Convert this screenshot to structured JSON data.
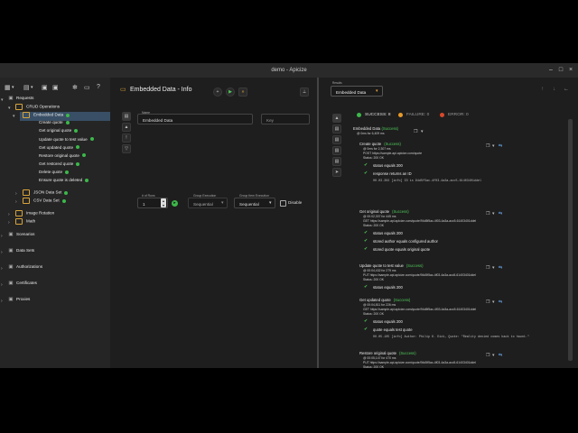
{
  "window": {
    "title": "demo - Apicize"
  },
  "sidebar": {
    "items": [
      {
        "label": "Requests",
        "indent": 0,
        "kind": "icon",
        "chev": "▾"
      },
      {
        "label": "CRUD Operations",
        "indent": 1,
        "kind": "folder",
        "chev": "▾"
      },
      {
        "label": "Embedded Data",
        "indent": 2,
        "kind": "folder",
        "chev": "▾",
        "dot": true,
        "selected": true
      },
      {
        "label": "Create quote",
        "indent": 3,
        "dot": true
      },
      {
        "label": "Get original quote",
        "indent": 3,
        "dot": true
      },
      {
        "label": "Update quote to test value",
        "indent": 3,
        "dot": true
      },
      {
        "label": "Get updated quote",
        "indent": 3,
        "dot": true
      },
      {
        "label": "Restore original quote",
        "indent": 3,
        "dot": true
      },
      {
        "label": "Get restored quote",
        "indent": 3,
        "dot": true
      },
      {
        "label": "Delete quote",
        "indent": 3,
        "dot": true
      },
      {
        "label": "Ensure quote is deleted",
        "indent": 3,
        "dot": true
      },
      {
        "label": "JSON Data Set",
        "indent": 2,
        "kind": "folder",
        "chev": "›",
        "dot": true
      },
      {
        "label": "CSV Data Set",
        "indent": 2,
        "kind": "folder",
        "chev": "›",
        "dot": true
      },
      {
        "label": "Image Rotation",
        "indent": 1,
        "kind": "folder",
        "chev": "›"
      },
      {
        "label": "Math",
        "indent": 1,
        "kind": "folder",
        "chev": "›"
      },
      {
        "label": "Scenarios",
        "indent": 0,
        "kind": "icon",
        "chev": "›"
      },
      {
        "label": "Data Sets",
        "indent": 0,
        "kind": "icon",
        "chev": "›"
      },
      {
        "label": "Authorizations",
        "indent": 0,
        "kind": "icon",
        "chev": "›"
      },
      {
        "label": "Certificates",
        "indent": 0,
        "kind": "icon",
        "chev": "›"
      },
      {
        "label": "Proxies",
        "indent": 0,
        "kind": "icon",
        "chev": "›"
      }
    ]
  },
  "center": {
    "title": "Embedded Data - Info",
    "name_label": "Name",
    "name_value": "Embedded Data",
    "key_placeholder": "Key",
    "runs_label": "# of Runs",
    "runs_value": "1",
    "group_exec_label": "Group Execution",
    "group_exec_value": "Sequential",
    "group_item_exec_label": "Group Item Execution",
    "group_item_exec_value": "Sequential",
    "disable_label": "Disable"
  },
  "right": {
    "results_label": "Results",
    "results_value": "Embedded Data",
    "success_label": "SUCCESS: 8",
    "failure_label": "FAILURE: 0",
    "error_label": "ERROR: 0",
    "root_title": "Embedded Data",
    "root_status": "(Success)",
    "root_time": "@ 0ms for 6,409 ms",
    "sections": [
      {
        "title": "Create quote",
        "status": "(Success)",
        "time": "@ 0ms for 2,307 ms",
        "url": "POST https://sample-api.apicize.com/quote",
        "code": "Status: 200 OK",
        "checks": [
          "status equals 200",
          "response returns an ID"
        ],
        "log": "00.03.302 [info] ID is 94d5f5ac-4f03-4a3a-acc5-61403401ddel"
      },
      {
        "title": "Get original quote",
        "status": "(Success)",
        "time": "@ 00:02,307 for 445 ms",
        "url": "GET https://sample-api.apicize.com/quote/94d5f5ac-4f03-4a3a-acc5-61403401ddel",
        "code": "Status: 200 OK",
        "checks": [
          "status equals 200",
          "stored author equals configured author",
          "stored quote equals original quote"
        ]
      },
      {
        "title": "Update quote to test value",
        "status": "(Success)",
        "time": "@ 00:04,432 for 279 ms",
        "url": "PUT https://sample-api.apicize.com/quote/94d5f5ac-4f03-4a3a-acc5-61403401ddel",
        "code": "Status: 200 OK",
        "checks": [
          "status equals 200"
        ]
      },
      {
        "title": "Get updated quote",
        "status": "(Success)",
        "time": "@ 00:04,811 for 226 ms",
        "url": "GET https://sample-api.apicize.com/quote/94d5f5ac-4f03-4a3a-acc5-61403401ddel",
        "code": "Status: 200 OK",
        "checks": [
          "status equals 200",
          "quote equals test quote"
        ],
        "log": "00.05.105 [info] Author: Philip K. Dick, Quote: \"Reality denied comes back to haunt.\""
      },
      {
        "title": "Restore original quote",
        "status": "(Success)",
        "time": "@ 00:05,147 for 470 ms",
        "url": "PUT https://sample-api.apicize.com/quote/94d5f5ac-4f03-4a3a-acc5-61403401ddel",
        "code": "Status: 200 OK",
        "checks": [
          "status equals 200"
        ]
      }
    ]
  }
}
